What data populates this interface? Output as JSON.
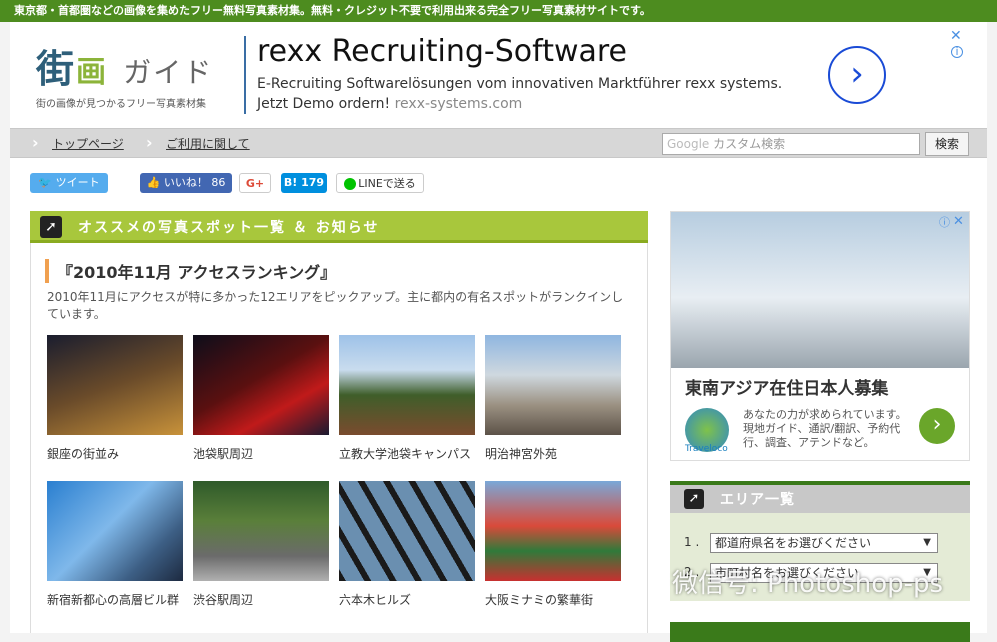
{
  "topbar": {
    "text": "東京都・首都圏などの画像を集めたフリー無料写真素材集。無料・クレジット不要で利用出来る完全フリー写真素材サイトです。"
  },
  "logo": {
    "main1": "街",
    "main2": "画",
    "main3": "ガイド",
    "sub": "街の画像が見つかるフリー写真素材集"
  },
  "header_ad": {
    "title": "rexx Recruiting-Software",
    "desc": "E-Recruiting Softwarelösungen vom innovativen Marktführer rexx systems. Jetzt Demo ordern!",
    "url": "rexx-systems.com",
    "go": "›",
    "close": "✕",
    "info": "i"
  },
  "nav": {
    "items": [
      "トップページ",
      "ご利用に関して"
    ],
    "search_logo": "Google",
    "search_placeholder": "カスタム検索",
    "search_button": "検索"
  },
  "social": {
    "tweet": "ツイート",
    "like": "いいね！ 86",
    "gplus": "G+",
    "hatena": "B! 179",
    "line": "LINEで送る"
  },
  "main": {
    "section_title": "オススメの写真スポット一覧 ＆ お知らせ",
    "section_icon": "➚",
    "article_title": "『2010年11月 アクセスランキング』",
    "article_desc": "2010年11月にアクセスが特に多かった12エリアをピックアップ。主に都内の有名スポットがランクインしています。",
    "photos": [
      {
        "caption": "銀座の街並み"
      },
      {
        "caption": "池袋駅周辺"
      },
      {
        "caption": "立教大学池袋キャンパス"
      },
      {
        "caption": "明治神宮外苑"
      },
      {
        "caption": "新宿新都心の高層ビル群"
      },
      {
        "caption": "渋谷駅周辺"
      },
      {
        "caption": "六本木ヒルズ"
      },
      {
        "caption": "大阪ミナミの繁華街"
      }
    ]
  },
  "side_ad": {
    "title": "東南アジア在住日本人募集",
    "text": "あなたの力が求められています。現地ガイド、通訳/翻訳、予約代行、調査、アテンドなど。",
    "logo_label": "Traveloco",
    "go": "›",
    "close": "✕",
    "info": "ⓘ"
  },
  "area": {
    "title": "エリア一覧",
    "icon": "➚",
    "rows": [
      {
        "num": "1 .",
        "value": "都道府県名をお選びください"
      },
      {
        "num": "2 .",
        "value": "市町村名をお選びください"
      }
    ]
  },
  "watermark": "微信号: Photoshop-ps",
  "colors": {
    "topbar": "#4d8c1f",
    "section_green": "#a8c73c",
    "accent_orange": "#f0a050"
  }
}
